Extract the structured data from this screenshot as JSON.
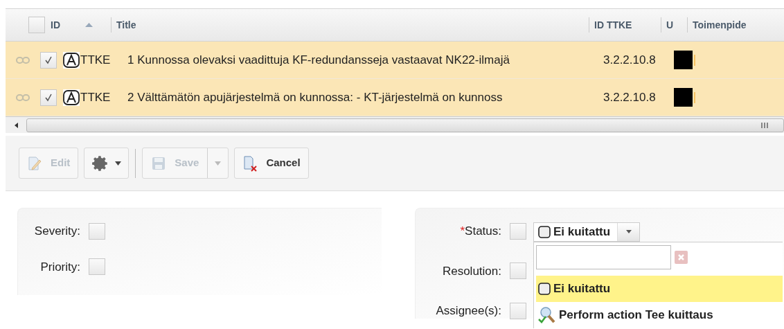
{
  "table": {
    "columns": [
      {
        "label": "ID",
        "sorted": true
      },
      {
        "label": "Title"
      },
      {
        "label": "ID TTKE"
      },
      {
        "label": "U"
      },
      {
        "label": "Toimenpide"
      }
    ],
    "rows": [
      {
        "selected": true,
        "id": "TTKE",
        "title": "1 Kunnossa olevaksi vaadittuja KF-redundansseja vastaavat NK22-ilmajä",
        "id_ttke": "3.2.2.10.8"
      },
      {
        "selected": true,
        "id": "TTKE",
        "title": "2 Välttämätön apujärjestelmä on kunnossa: - KT-järjestelmä on kunnoss",
        "id_ttke": "3.2.2.10.8"
      }
    ],
    "header_checked": false
  },
  "toolbar": [
    {
      "kind": "edit",
      "label": "Edit",
      "disabled": true
    },
    {
      "kind": "gear",
      "disabled": false
    },
    {
      "kind": "save",
      "label": "Save",
      "disabled": true
    },
    {
      "kind": "cancel",
      "label": "Cancel",
      "disabled": false
    }
  ],
  "left_fields": [
    {
      "label": "Severity:",
      "checked": false
    },
    {
      "label": "Priority:",
      "checked": false
    }
  ],
  "right_fields": [
    {
      "label": "Status:",
      "required_mark": "*",
      "checked": false
    },
    {
      "label": "Resolution:",
      "checked": false
    },
    {
      "label": "Assignee(s):",
      "checked": false
    }
  ],
  "status_select": {
    "value": "Ei kuitattu",
    "options": [
      {
        "kind": "state",
        "label": "Ei kuitattu",
        "selected": true
      },
      {
        "kind": "action",
        "label": "Perform action Tee kuittaus",
        "selected": false
      }
    ]
  }
}
